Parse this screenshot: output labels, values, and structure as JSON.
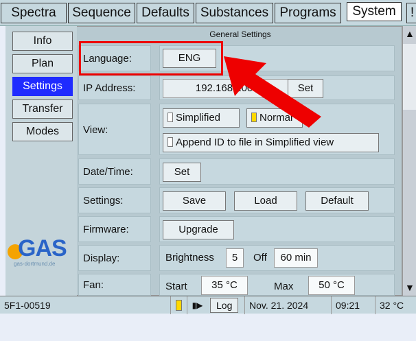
{
  "tabs": [
    {
      "label": "Spectra",
      "active": false
    },
    {
      "label": "Sequence",
      "active": false
    },
    {
      "label": "Defaults",
      "active": false
    },
    {
      "label": "Substances",
      "active": false
    },
    {
      "label": "Programs",
      "active": false
    },
    {
      "label": "System",
      "active": true
    },
    {
      "label": "!",
      "active": false
    }
  ],
  "nav": [
    {
      "label": "Info",
      "active": false
    },
    {
      "label": "Plan",
      "active": false
    },
    {
      "label": "Settings",
      "active": true
    },
    {
      "label": "Transfer",
      "active": false
    },
    {
      "label": "Modes",
      "active": false
    }
  ],
  "section_title": "General Settings",
  "rows": {
    "language": {
      "label": "Language:",
      "value": "ENG"
    },
    "ip": {
      "label": "IP Address:",
      "value": "192.168.100.95",
      "button": "Set"
    },
    "view": {
      "label": "View:",
      "option1": "Simplified",
      "option2": "Normal",
      "append": "Append ID to file in Simplified view",
      "option1_checked": false,
      "option2_checked": true
    },
    "datetime": {
      "label": "Date/Time:",
      "button": "Set"
    },
    "settings": {
      "label": "Settings:",
      "save": "Save",
      "load": "Load",
      "default": "Default"
    },
    "firmware": {
      "label": "Firmware:",
      "button": "Upgrade"
    },
    "display": {
      "label": "Display:",
      "brightness_label": "Brightness",
      "brightness_value": "5",
      "off_label": "Off",
      "off_value": "60 min"
    },
    "fan": {
      "label": "Fan:",
      "start_label": "Start",
      "start_value": "35 °C",
      "max_label": "Max",
      "max_value": "50 °C"
    }
  },
  "logo": {
    "text": "GAS",
    "sub": "gas-dortmund.de"
  },
  "status": {
    "device_id": "5F1-00519",
    "log_label": "Log",
    "date": "Nov. 21. 2024",
    "time": "09:21",
    "temperature": "32 °C"
  },
  "colors": {
    "accent_active": "#1f2bff",
    "highlight": "#ee0000",
    "checkbox_on": "#ffd900"
  }
}
